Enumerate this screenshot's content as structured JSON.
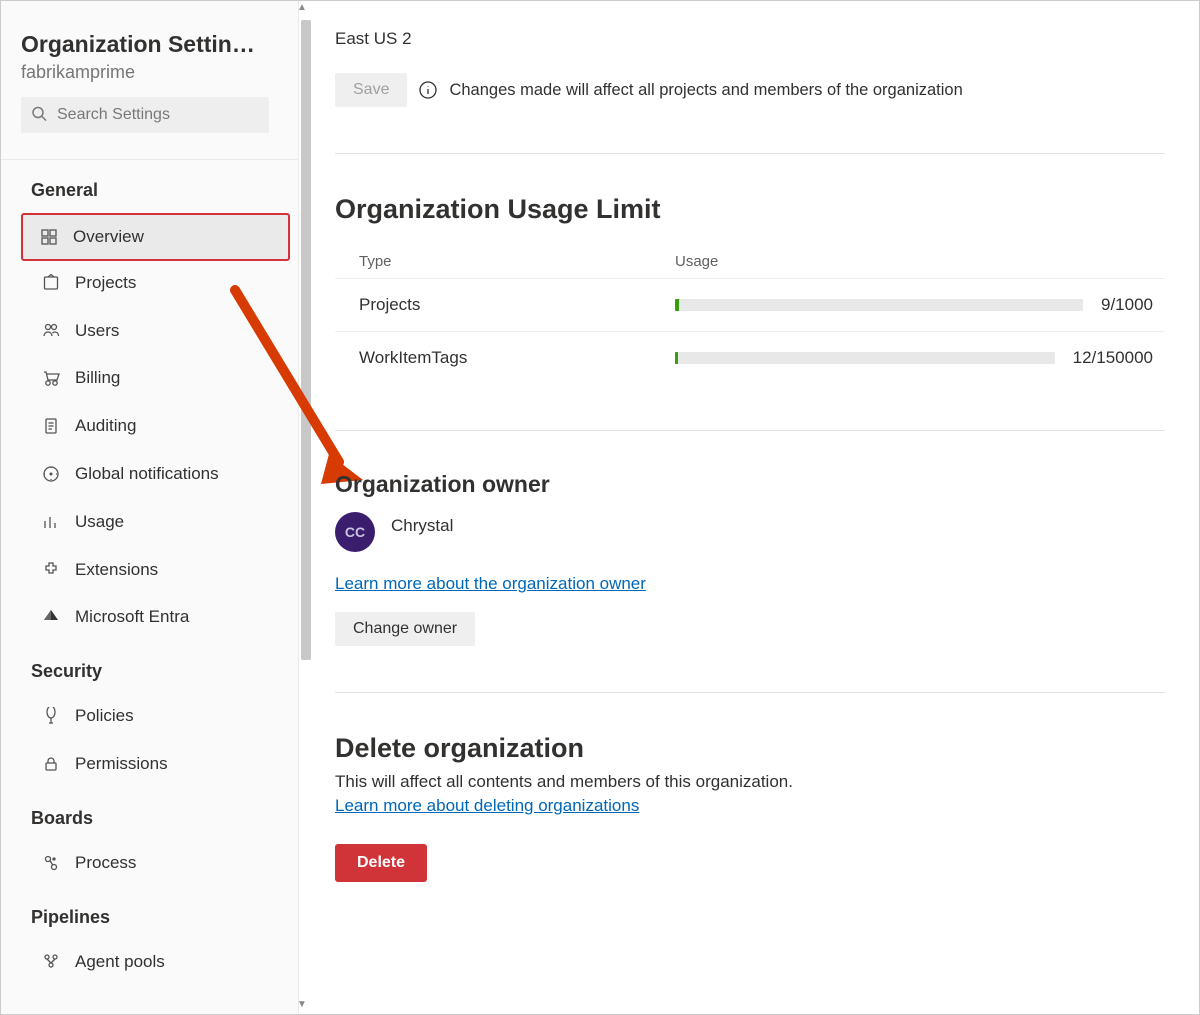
{
  "sidebar": {
    "title": "Organization Settin…",
    "org_name": "fabrikamprime",
    "search_placeholder": "Search Settings",
    "groups": [
      {
        "label": "General",
        "items": [
          {
            "label": "Overview",
            "active": true,
            "highlighted": true,
            "icon": "overview"
          },
          {
            "label": "Projects",
            "icon": "projects"
          },
          {
            "label": "Users",
            "icon": "users"
          },
          {
            "label": "Billing",
            "icon": "billing"
          },
          {
            "label": "Auditing",
            "icon": "auditing"
          },
          {
            "label": "Global notifications",
            "icon": "notifications"
          },
          {
            "label": "Usage",
            "icon": "usage"
          },
          {
            "label": "Extensions",
            "icon": "extensions"
          },
          {
            "label": "Microsoft Entra",
            "icon": "entra"
          }
        ]
      },
      {
        "label": "Security",
        "items": [
          {
            "label": "Policies",
            "icon": "policies"
          },
          {
            "label": "Permissions",
            "icon": "permissions"
          }
        ]
      },
      {
        "label": "Boards",
        "items": [
          {
            "label": "Process",
            "icon": "process"
          }
        ]
      },
      {
        "label": "Pipelines",
        "items": [
          {
            "label": "Agent pools",
            "icon": "agent-pools"
          }
        ]
      }
    ]
  },
  "main": {
    "region_value": "East US 2",
    "save_label": "Save",
    "changes_note": "Changes made will affect all projects and members of the organization",
    "usage": {
      "heading": "Organization Usage Limit",
      "col_type": "Type",
      "col_usage": "Usage",
      "rows": [
        {
          "type": "Projects",
          "value": 9,
          "limit": 1000,
          "label": "9/1000"
        },
        {
          "type": "WorkItemTags",
          "value": 12,
          "limit": 150000,
          "label": "12/150000"
        }
      ]
    },
    "owner": {
      "heading": "Organization owner",
      "avatar_initials": "CC",
      "name": "Chrystal",
      "learn_more": "Learn more about the organization owner",
      "change_label": "Change owner"
    },
    "delete": {
      "heading": "Delete organization",
      "description": "This will affect all contents and members of this organization.",
      "learn_more": "Learn more about deleting organizations",
      "button_label": "Delete"
    }
  }
}
